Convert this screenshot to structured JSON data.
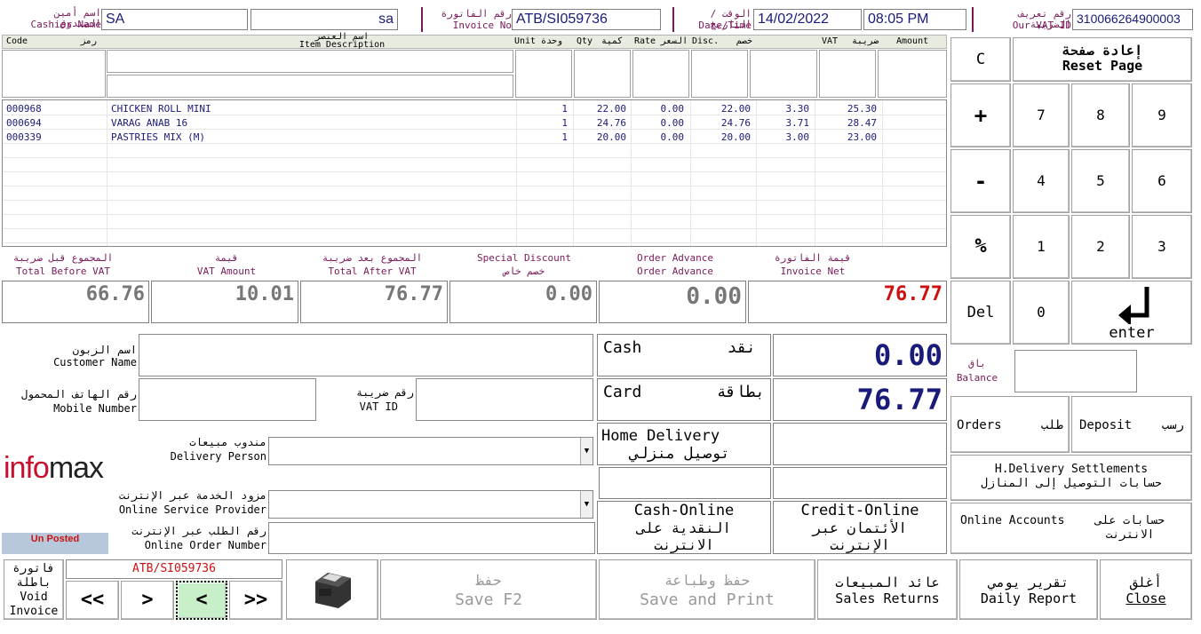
{
  "header": {
    "cashier_label_ar": "اسم أمين الصندوق",
    "cashier_label_en": "Cashier Name",
    "cashier_code": "SA",
    "cashier_name": "sa",
    "invoice_label_ar": "رقم الفاتورة",
    "invoice_label_en": "Invoice No",
    "invoice_no": "ATB/SI059736",
    "date_label_ar": "الوقت / التاريخ",
    "date_label_en": "Date/Time",
    "date": "14/02/2022",
    "time": "08:05 PM",
    "vat_label_ar": "رقم تعريف الضريبة",
    "vat_label_en": "Our VAT ID",
    "vat_id": "310066264900003"
  },
  "grid": {
    "columns": [
      {
        "en": "Code",
        "ar": "رمز"
      },
      {
        "en": "Item Description",
        "ar": "اسم العنصر"
      },
      {
        "en": "Unit",
        "ar": "وحدة"
      },
      {
        "en": "Qty",
        "ar": "كمية"
      },
      {
        "en": "Rate",
        "ar": "السعر"
      },
      {
        "en": "Disc.",
        "ar": "خصم"
      },
      {
        "en": "VAT",
        "ar": "ضريبة"
      },
      {
        "en": "Amount",
        "ar": ""
      }
    ],
    "rows": [
      {
        "code": "000968",
        "desc": "CHICKEN ROLL MINI",
        "unit": "1",
        "qty": "22.00",
        "rate": "0.00",
        "disc": "22.00",
        "vat": "3.30",
        "amount": "25.30"
      },
      {
        "code": "000694",
        "desc": "VARAG ANAB 16",
        "unit": "1",
        "qty": "24.76",
        "rate": "0.00",
        "disc": "24.76",
        "vat": "3.71",
        "amount": "28.47"
      },
      {
        "code": "000339",
        "desc": "PASTRIES MIX (M)",
        "unit": "1",
        "qty": "20.00",
        "rate": "0.00",
        "disc": "20.00",
        "vat": "3.00",
        "amount": "23.00"
      }
    ]
  },
  "totals": {
    "before_vat_ar": "المجموع قبل ضريبة",
    "before_vat_en": "Total Before VAT",
    "before_vat": "66.76",
    "vat_amount_ar": "قيمة",
    "vat_amount_en": "VAT Amount",
    "vat_amount": "10.01",
    "after_vat_ar": "المجموع بعد ضريبة",
    "after_vat_en": "Total After VAT",
    "after_vat": "76.77",
    "special_en": "Special Discount",
    "special_ar": "خصم خاص",
    "special": "0.00",
    "advance_en1": "Order Advance",
    "advance_en2": "Order Advance",
    "advance": "0.00",
    "net_ar": "قيمة الفاتورة",
    "net_en": "Invoice Net",
    "net": "76.77"
  },
  "customer": {
    "name_ar": "اسم الزبون",
    "name_en": "Customer Name",
    "mobile_ar": "رقم الهاتف المحمول",
    "mobile_en": "Mobile Number",
    "vat_ar": "رقم ضريبة",
    "vat_en": "VAT ID",
    "delivery_ar": "مندوب مبيعات",
    "delivery_en": "Delivery Person",
    "provider_ar": "مزود الخدمة عبر الإنترنت",
    "provider_en": "Online Service Provider",
    "order_ar": "رقم الطلب عبر الإنترنت",
    "order_en": "Online Order Number"
  },
  "brand": {
    "logo": "infomax",
    "status": "Un Posted"
  },
  "payment": {
    "cash_en": "Cash",
    "cash_ar": "نقد",
    "cash_value": "0.00",
    "card_en": "Card",
    "card_ar": "بطاقة",
    "card_value": "76.77",
    "home_en": "Home Delivery",
    "home_ar": "توصيل منزلي",
    "cash_online_en": "Cash-Online",
    "cash_online_ar": "النقدية على الانترنت",
    "credit_online_en": "Credit-Online",
    "credit_online_ar": "الأئتمان عبر الإنترنت"
  },
  "keypad": {
    "reset_ar": "إعادة صفحة",
    "reset_en": "Reset Page",
    "clear": "C",
    "plus": "+",
    "minus": "-",
    "percent": "%",
    "del": "Del",
    "enter": "enter",
    "digits": [
      "7",
      "8",
      "9",
      "4",
      "5",
      "6",
      "1",
      "2",
      "3",
      "0"
    ],
    "balance_ar": "باق",
    "balance_en": "Balance",
    "orders_en": "Orders",
    "orders_ar": "طلب",
    "deposit_en": "Deposit",
    "deposit_ar": "رسب",
    "hdel_en": "H.Delivery Settlements",
    "hdel_ar": "حسابات التوصيل إلى المنازل",
    "online_en": "Online Accounts",
    "online_ar": "حسابات على الانترنت"
  },
  "footer": {
    "void_ar": "فاتورة باطلة",
    "void_en": "Void Invoice",
    "nav_invoice": "ATB/SI059736",
    "first": "<<",
    "prev": ">",
    "next": "<",
    "last": ">>",
    "save_ar": "حفظ",
    "save_en": "Save  F2",
    "print_ar": "حفظ وطباعة",
    "print_en": "Save and Print",
    "returns_ar": "عائد المبيعات",
    "returns_en": "Sales Returns",
    "daily_ar": "تقرير يومي",
    "daily_en": "Daily Report",
    "close_ar": "أغلق",
    "close_en": "Close"
  },
  "colors": {
    "label": "#7a1a5a",
    "value": "#1a1a7a",
    "net": "#cc1111",
    "highlight": "#c8f0c8"
  }
}
